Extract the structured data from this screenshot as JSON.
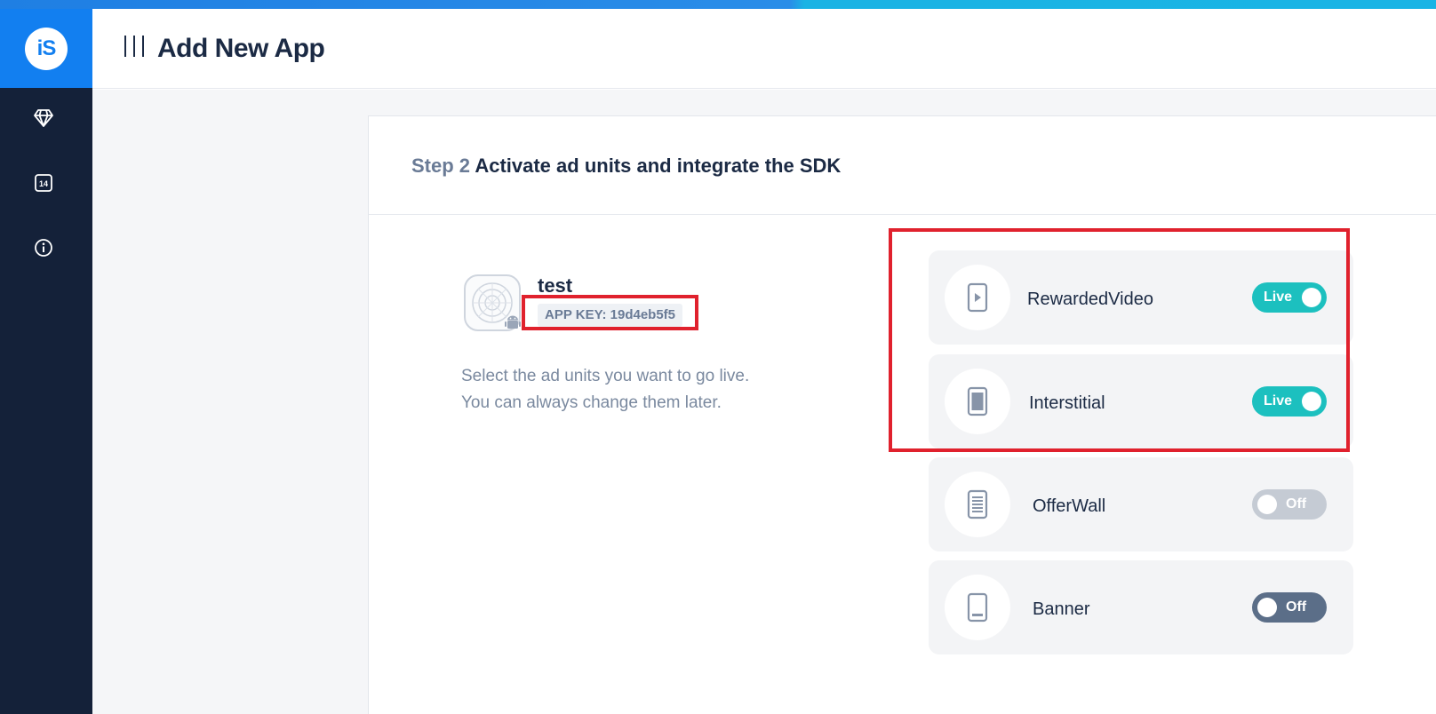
{
  "header": {
    "title": "Add New App"
  },
  "sidebar": {
    "logo_text": "iS",
    "items": [
      {
        "icon": "diamond-icon"
      },
      {
        "icon": "calendar-icon",
        "badge": "14"
      },
      {
        "icon": "info-icon"
      }
    ]
  },
  "step": {
    "number": "Step 2",
    "title": "Activate ad units and integrate the SDK"
  },
  "app": {
    "name": "test",
    "app_key": "APP KEY: 19d4eb5f5",
    "description_line1": "Select the ad units you want to go live.",
    "description_line2": "You can always change them later."
  },
  "ad_units": [
    {
      "label": "RewardedVideo",
      "icon": "rewarded-video-icon",
      "status": "Live"
    },
    {
      "label": "Interstitial",
      "icon": "interstitial-icon",
      "status": "Live"
    },
    {
      "label": "OfferWall",
      "icon": "offerwall-icon",
      "status": "Off"
    },
    {
      "label": "Banner",
      "icon": "banner-icon",
      "status": "Off"
    }
  ],
  "colors": {
    "brand_blue": "#127ff0",
    "sidebar": "#142139",
    "live_toggle": "#1cc0bf",
    "off_toggle_light": "#c5cbd4",
    "off_toggle_dark": "#5b6e88",
    "highlight_red": "#e0212d"
  }
}
